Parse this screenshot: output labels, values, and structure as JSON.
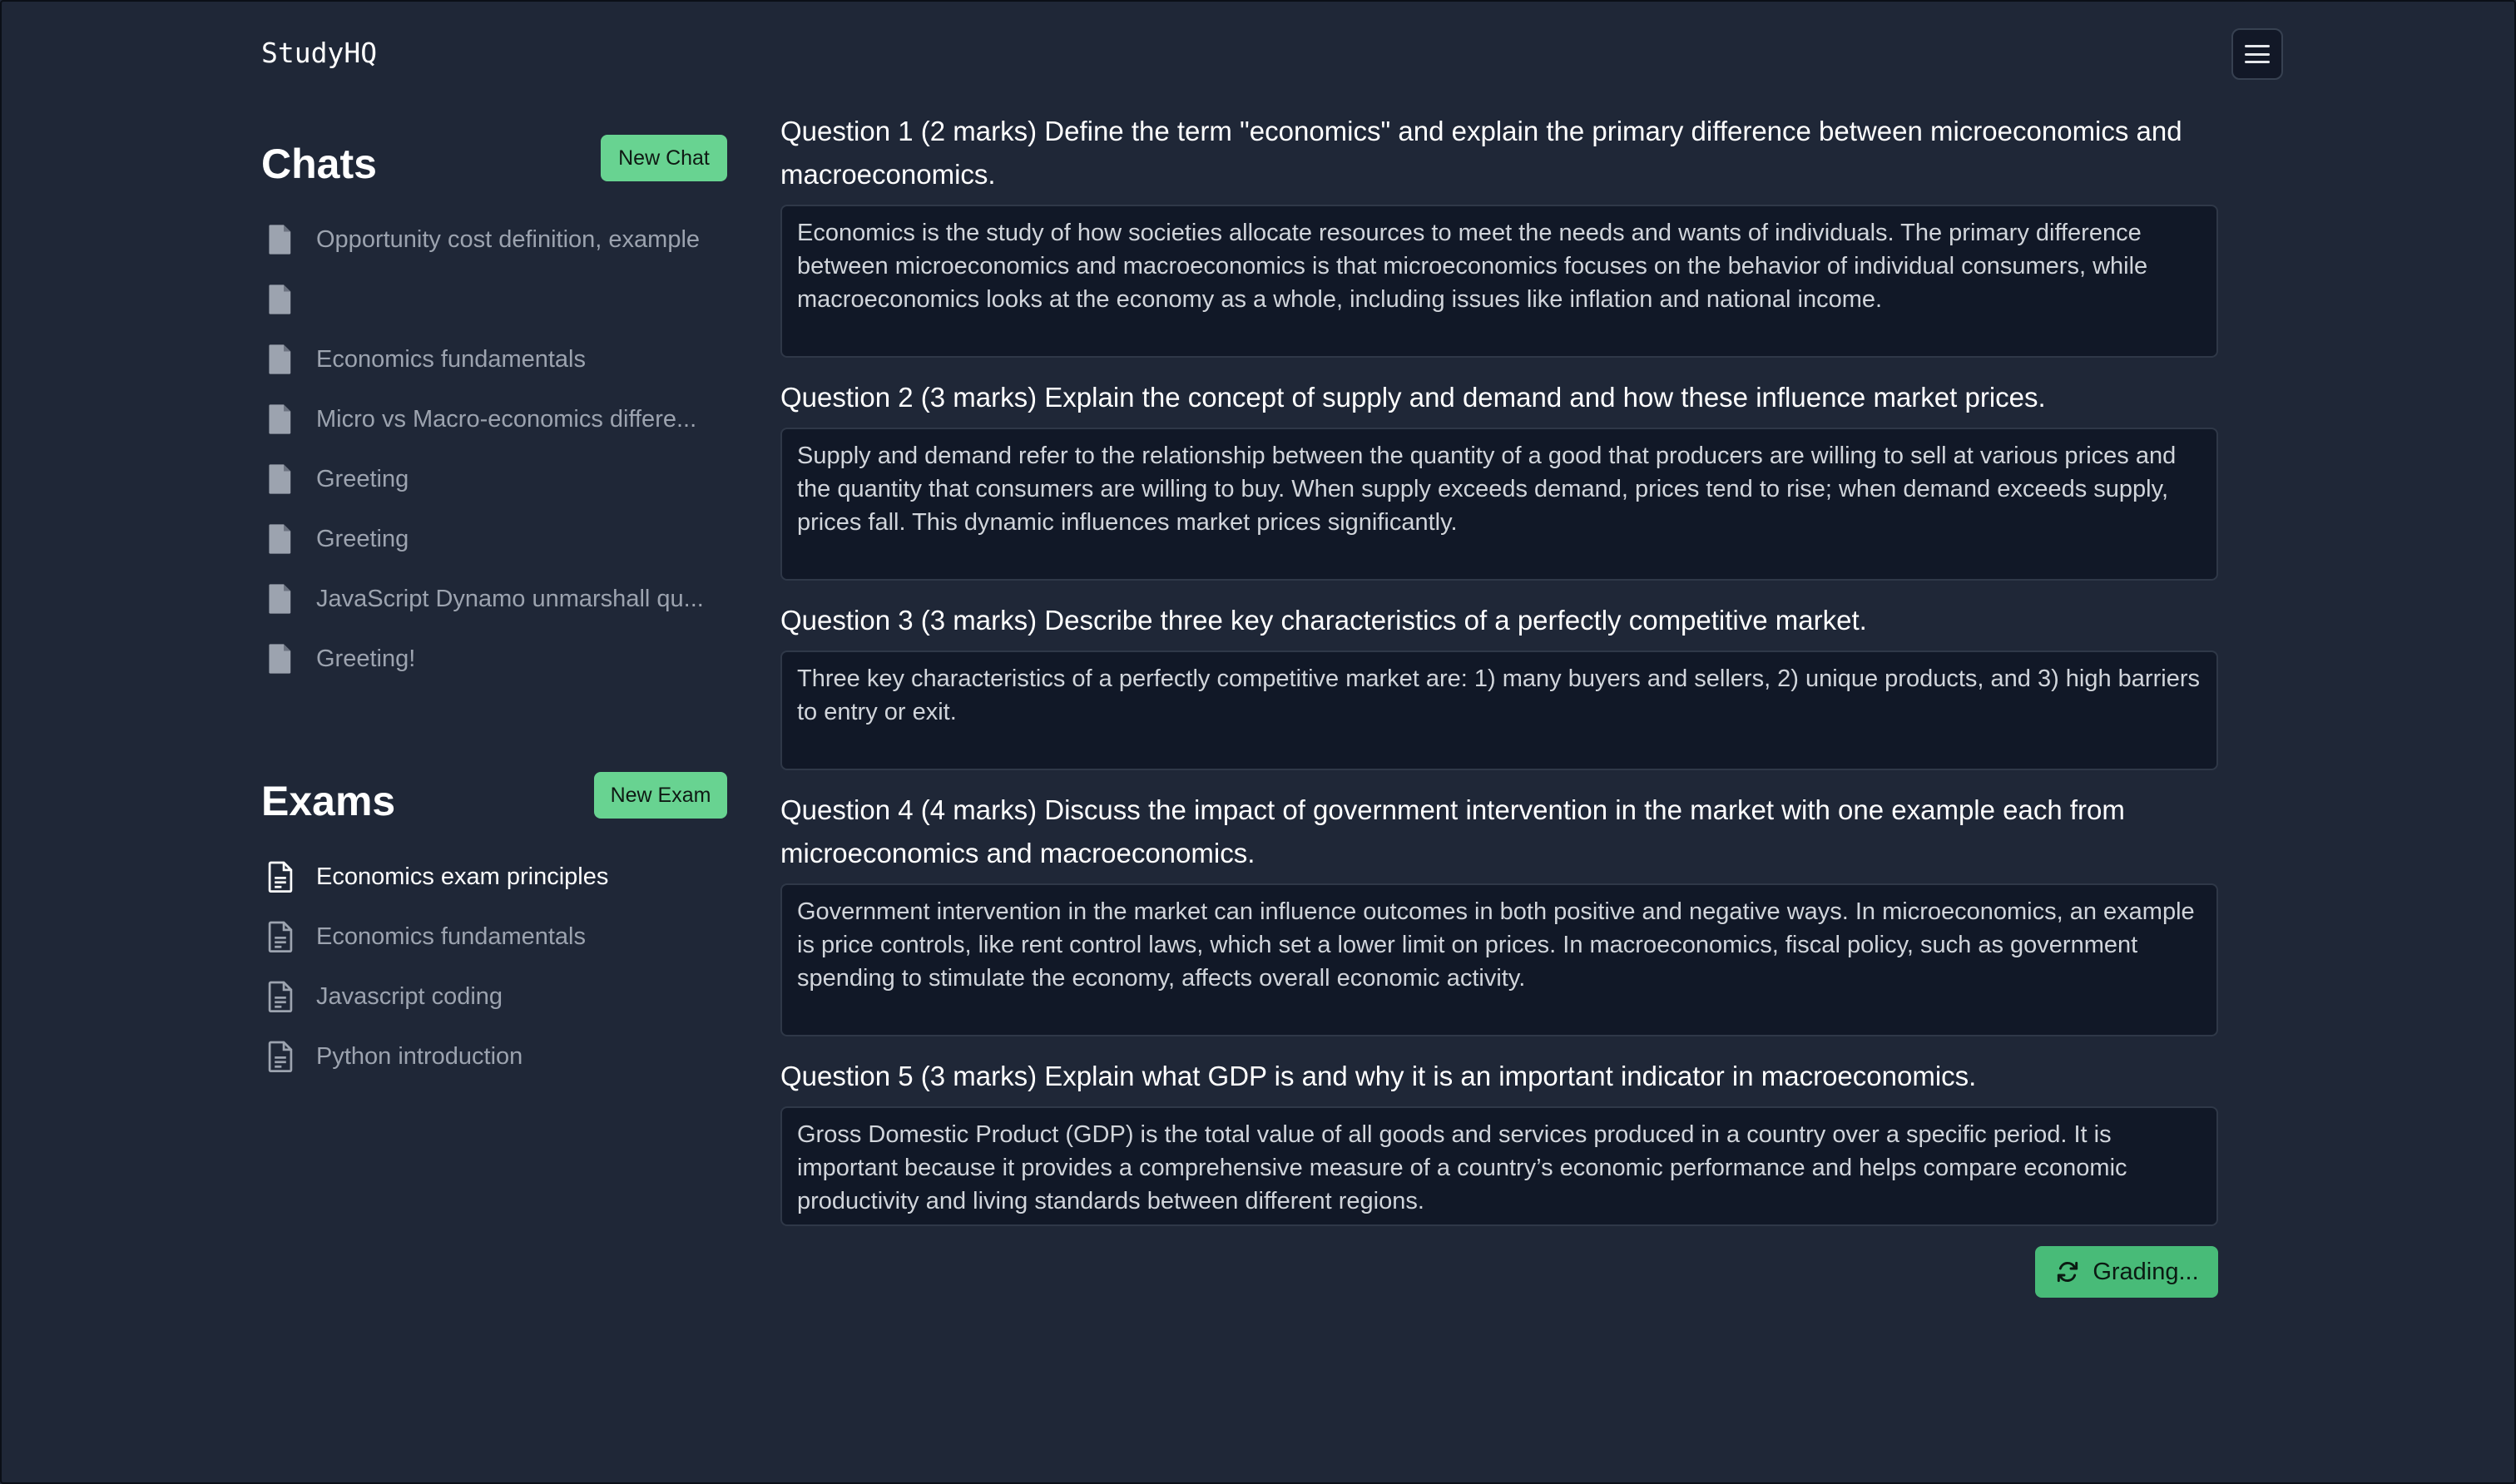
{
  "app": {
    "brand": "StudyHQ"
  },
  "header": {
    "menu_icon": "hamburger-menu-icon"
  },
  "chats": {
    "title": "Chats",
    "new_button": "New Chat",
    "items": [
      {
        "label": "Opportunity cost definition, example",
        "icon": "file-filled-icon"
      },
      {
        "label": "",
        "icon": "file-filled-icon"
      },
      {
        "label": "Economics fundamentals",
        "icon": "file-filled-icon"
      },
      {
        "label": "Micro vs Macro-economics differe...",
        "icon": "file-filled-icon"
      },
      {
        "label": "Greeting",
        "icon": "file-filled-icon"
      },
      {
        "label": "Greeting",
        "icon": "file-filled-icon"
      },
      {
        "label": "JavaScript Dynamo unmarshall qu...",
        "icon": "file-filled-icon"
      },
      {
        "label": "Greeting!",
        "icon": "file-filled-icon"
      }
    ]
  },
  "exams": {
    "title": "Exams",
    "new_button": "New Exam",
    "items": [
      {
        "label": "Economics exam principles",
        "icon": "file-outline-icon",
        "active": true
      },
      {
        "label": "Economics fundamentals",
        "icon": "file-outline-icon"
      },
      {
        "label": "Javascript coding",
        "icon": "file-outline-icon"
      },
      {
        "label": "Python introduction",
        "icon": "file-outline-icon"
      }
    ]
  },
  "questions": [
    {
      "title": "Question 1 (2 marks) Define the term \"economics\" and explain the primary difference between microeconomics and macroeconomics.",
      "answer": "Economics is the study of how societies allocate resources to meet the needs and wants of individuals. The primary difference between microeconomics and macroeconomics is that microeconomics focuses on the behavior of individual consumers, while macroeconomics looks at the economy as a whole, including issues like inflation and national income."
    },
    {
      "title": "Question 2 (3 marks) Explain the concept of supply and demand and how these influence market prices.",
      "answer": "Supply and demand refer to the relationship between the quantity of a good that producers are willing to sell at various prices and the quantity that consumers are willing to buy. When supply exceeds demand, prices tend to rise; when demand exceeds supply, prices fall. This dynamic influences market prices significantly."
    },
    {
      "title": "Question 3 (3 marks) Describe three key characteristics of a perfectly competitive market.",
      "answer": "Three key characteristics of a perfectly competitive market are: 1) many buyers and sellers, 2) unique products, and 3) high barriers to entry or exit."
    },
    {
      "title": "Question 4 (4 marks) Discuss the impact of government intervention in the market with one example each from microeconomics and macroeconomics.",
      "answer": "Government intervention in the market can influence outcomes in both positive and negative ways. In microeconomics, an example is price controls, like rent control laws, which set a lower limit on prices. In macroeconomics, fiscal policy, such as government spending to stimulate the economy, affects overall economic activity."
    },
    {
      "title": "Question 5 (3 marks) Explain what GDP is and why it is an important indicator in macroeconomics.",
      "answer": "Gross Domestic Product (GDP) is the total value of all goods and services produced in a country over a specific period. It is important because it provides a comprehensive measure of a country’s economic performance and helps compare economic productivity and living standards between different regions."
    }
  ],
  "grading_button": {
    "label": "Grading...",
    "icon": "refresh-icon"
  },
  "colors": {
    "background": "#1f2737",
    "answer_bg": "#111827",
    "accent_green": "#68d391",
    "grading_green": "#48bb78"
  }
}
